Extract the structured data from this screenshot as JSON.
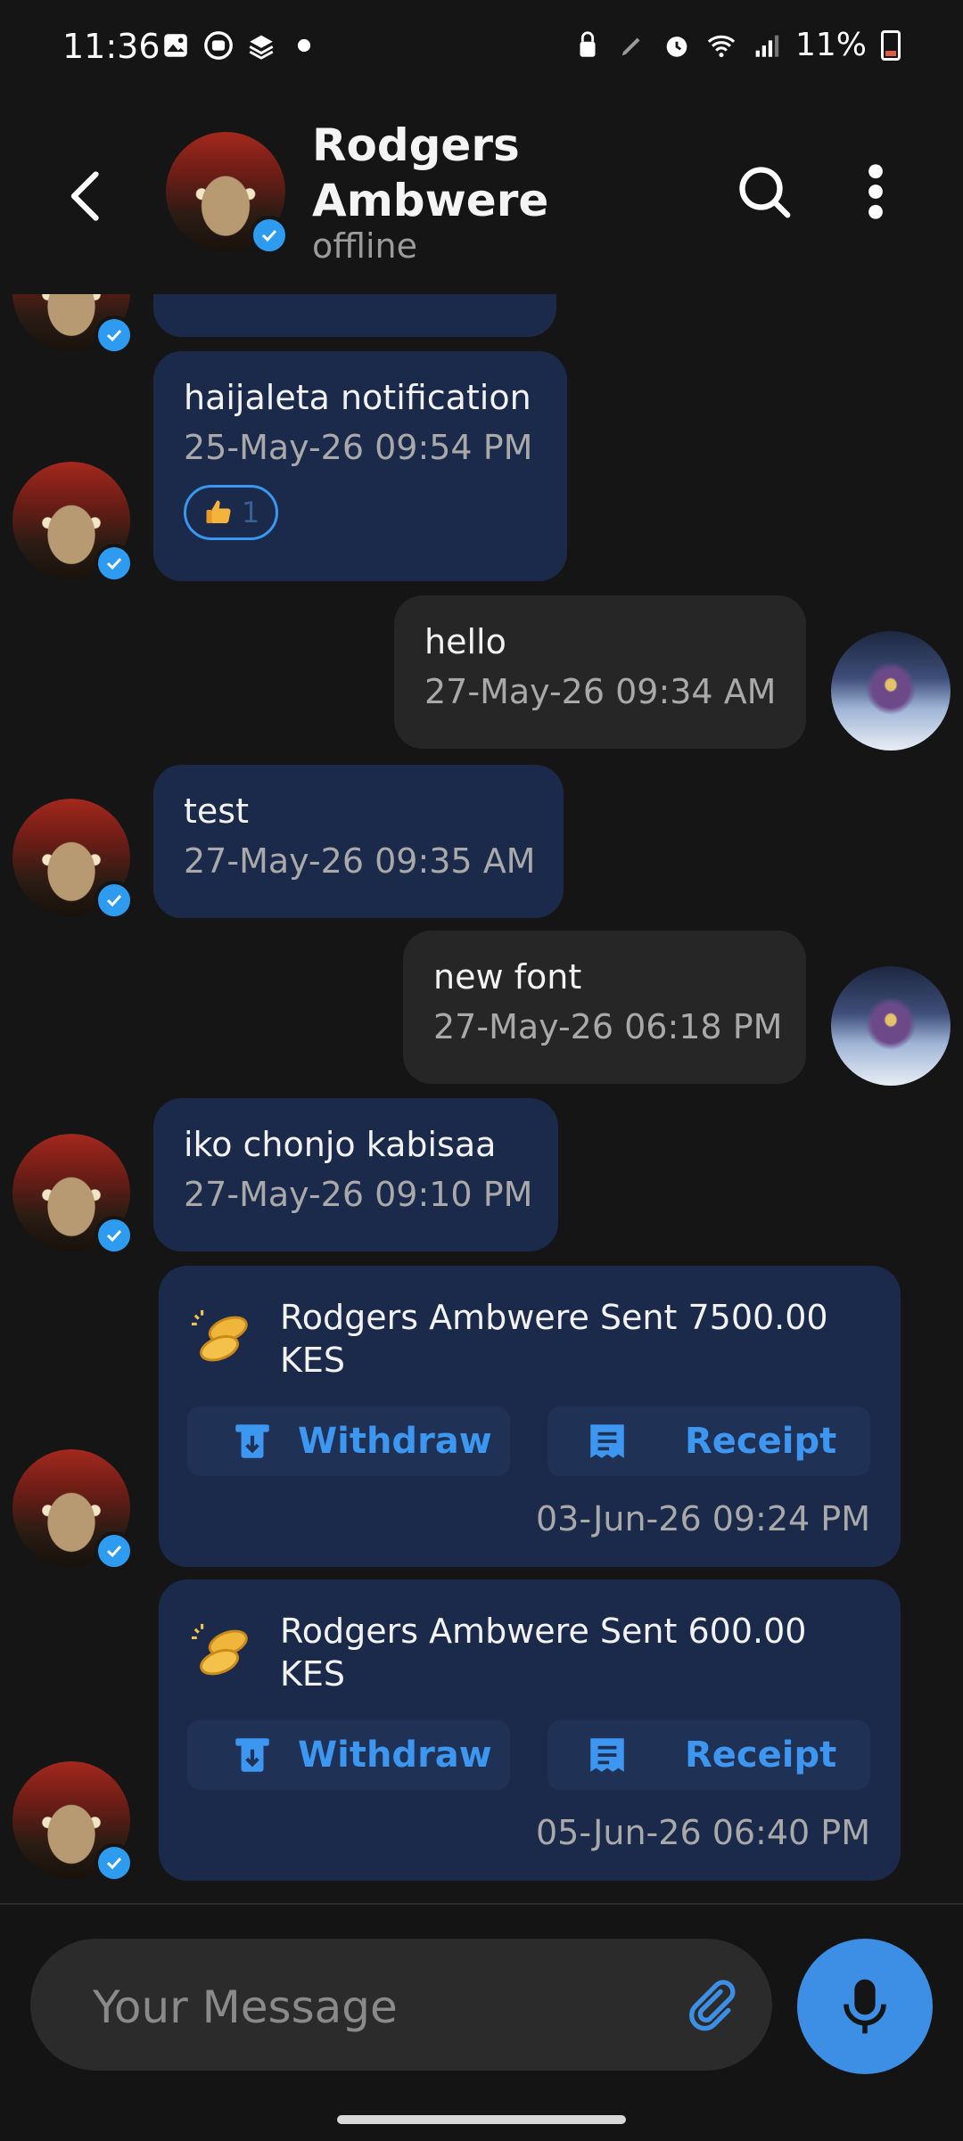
{
  "status_bar": {
    "time": "11:36",
    "battery": "11%"
  },
  "header": {
    "name": "Rodgers Ambwere",
    "presence": "offline",
    "back_icon": "chevron-left-icon",
    "search_icon": "search-icon",
    "more_icon": "more-vertical-icon"
  },
  "messages": [
    {
      "direction": "in",
      "text": "haijaleta notification",
      "timestamp": "25-May-26 09:54 PM",
      "reaction": {
        "emoji": "thumbs-up",
        "count": "1"
      }
    },
    {
      "direction": "out",
      "text": "hello",
      "timestamp": "27-May-26 09:34 AM"
    },
    {
      "direction": "in",
      "text": "test",
      "timestamp": "27-May-26 09:35 AM"
    },
    {
      "direction": "out",
      "text": "new font",
      "timestamp": "27-May-26 06:18 PM"
    },
    {
      "direction": "in",
      "text": "iko chonjo kabisaa",
      "timestamp": "27-May-26 09:10 PM"
    }
  ],
  "payments": [
    {
      "text": "Rodgers Ambwere Sent 7500.00 KES",
      "withdraw_label": "Withdraw",
      "receipt_label": "Receipt",
      "timestamp": "03-Jun-26 09:24 PM"
    },
    {
      "text": "Rodgers Ambwere Sent 600.00 KES",
      "withdraw_label": "Withdraw",
      "receipt_label": "Receipt",
      "timestamp": "05-Jun-26 06:40 PM"
    }
  ],
  "composer": {
    "placeholder": "Your Message",
    "attach_icon": "paperclip-icon",
    "mic_icon": "microphone-icon"
  },
  "colors": {
    "accent": "#3d8fe6",
    "incoming_bubble": "#1b2a4a",
    "outgoing_bubble": "#262626",
    "background": "#151515"
  }
}
